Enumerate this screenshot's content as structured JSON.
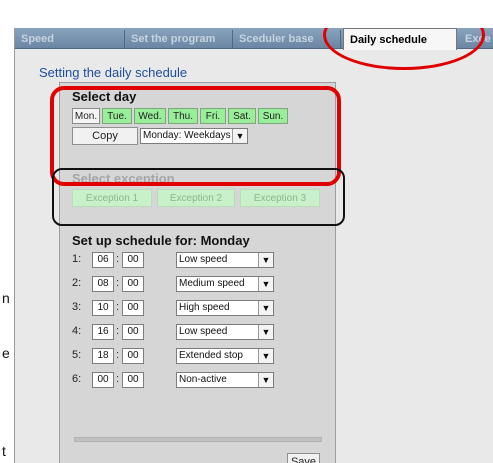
{
  "tabs": [
    {
      "label": "Speed"
    },
    {
      "label": "Set the program"
    },
    {
      "label": "Sceduler base"
    },
    {
      "label": "Daily schedule"
    },
    {
      "label": "Exce"
    }
  ],
  "page_title": "Setting the daily schedule",
  "select_day": {
    "title": "Select day",
    "days": [
      "Mon.",
      "Tue.",
      "Wed.",
      "Thu.",
      "Fri.",
      "Sat.",
      "Sun."
    ],
    "copy_label": "Copy",
    "copy_select_value": "Monday: Weekdays"
  },
  "select_exception": {
    "title": "Select exception",
    "buttons": [
      "Exception 1",
      "Exception 2",
      "Exception 3"
    ]
  },
  "schedule": {
    "title": "Set up schedule for: Monday",
    "rows": [
      {
        "label": "1:",
        "hour": "06",
        "minute": "00",
        "mode": "Low speed"
      },
      {
        "label": "2:",
        "hour": "08",
        "minute": "00",
        "mode": "Medium speed"
      },
      {
        "label": "3:",
        "hour": "10",
        "minute": "00",
        "mode": "High speed"
      },
      {
        "label": "4:",
        "hour": "16",
        "minute": "00",
        "mode": "Low speed"
      },
      {
        "label": "5:",
        "hour": "18",
        "minute": "00",
        "mode": "Extended stop"
      },
      {
        "label": "6:",
        "hour": "00",
        "minute": "00",
        "mode": "Non-active"
      }
    ],
    "time_sep": ":",
    "save_label": "Save"
  },
  "side_fragments": [
    "n",
    "e",
    "t"
  ],
  "colors": {
    "annotation_red": "#e00000",
    "day_button_green": "#99ee99",
    "exception_green": "#c9f1c9",
    "tab_bar": "#7c97b3",
    "title_blue": "#1f4e9c"
  }
}
